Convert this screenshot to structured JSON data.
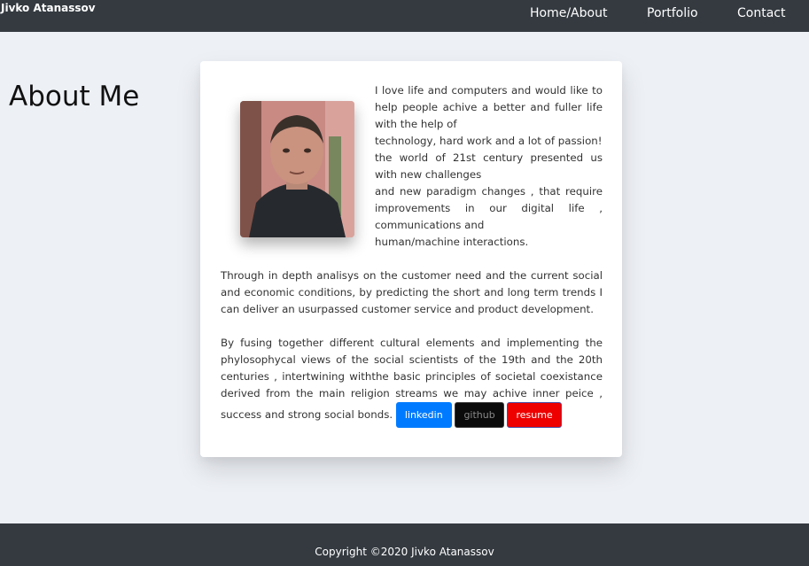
{
  "navbar": {
    "brand": "Jivko Atanassov",
    "links": [
      "Home/About",
      "Portfolio",
      "Contact"
    ]
  },
  "about": {
    "title": "About Me",
    "intro_lines": [
      "I love life and computers and would like to help people achive a better and fuller life with the help of",
      "technology, hard work and a lot of passion!",
      "the world of 21st century presented us with new challenges",
      "and new paradigm changes , that require improvements in our digital life , communications and",
      "human/machine interactions."
    ],
    "paragraph2": "Through in depth analisys on the customer need and the current social and economic conditions, by predicting the short and long term trends I can deliver an usurpassed customer service and product development.",
    "paragraph3": "By fusing together different cultural elements and implementing the phylosophycal views of the social scientists of the 19th and the 20th centuries , intertwining withthe basic principles of societal coexistance derived from the main religion streams we may achive inner peice , success and strong social bonds.",
    "buttons": {
      "linkedin": "linkedin",
      "github": "github",
      "resume": "resume"
    }
  },
  "footer": {
    "copyright": "Copyright ©2020 Jivko Atanassov"
  },
  "colors": {
    "navbar_bg": "#343a40",
    "page_bg": "#edf0f5",
    "linkedin": "#007bff",
    "github": "#0b0b0b",
    "resume": "#ee0000"
  }
}
